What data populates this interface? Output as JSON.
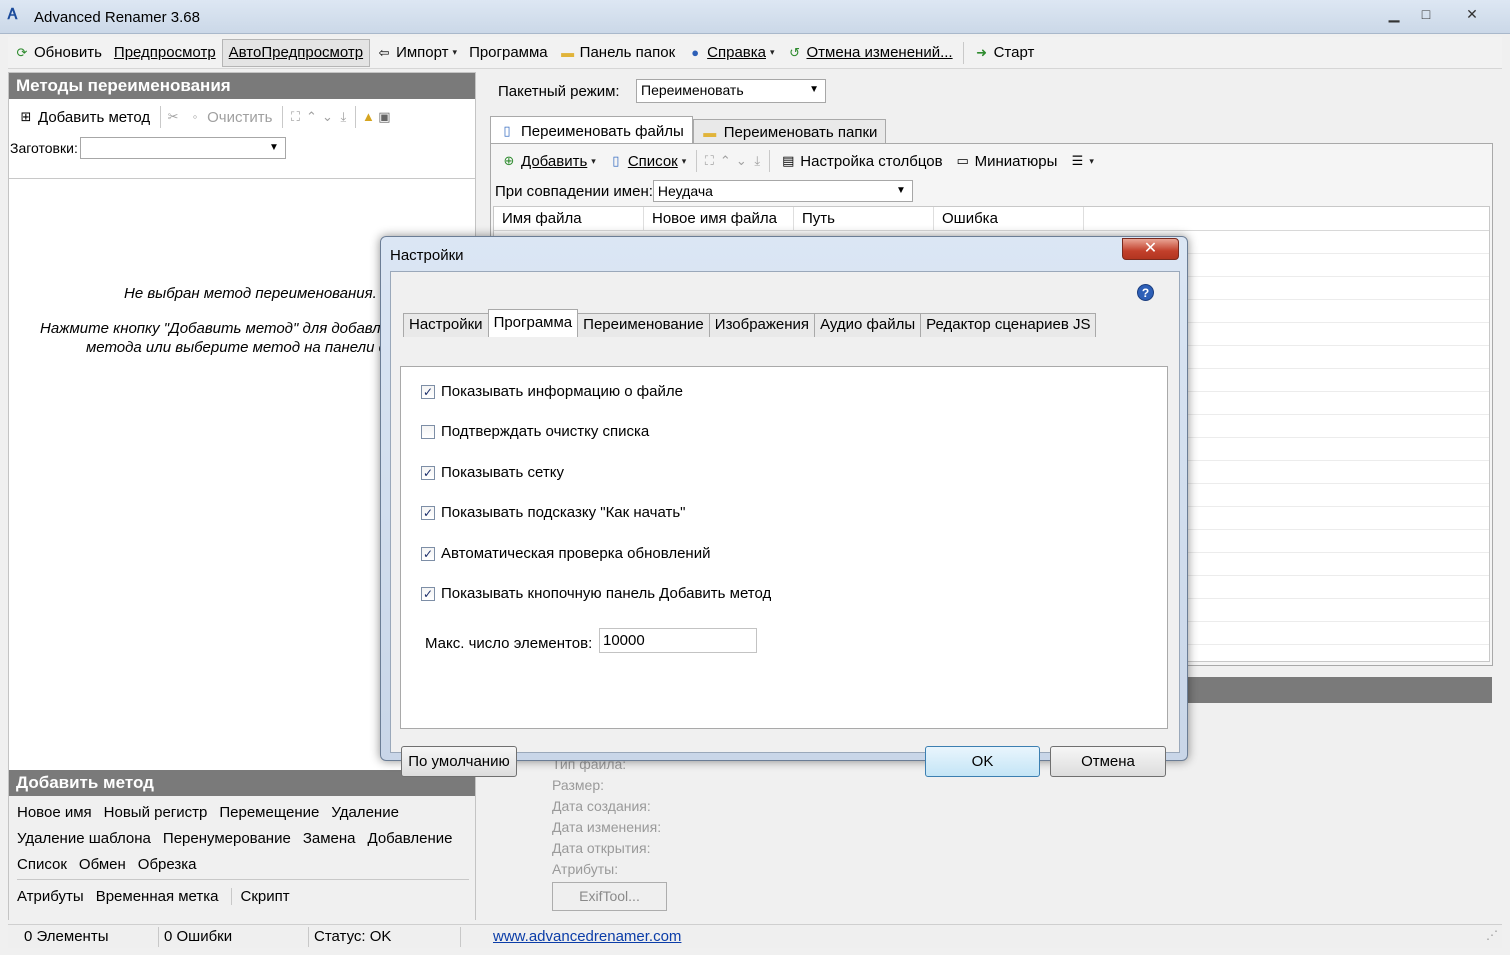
{
  "window": {
    "title": "Advanced Renamer 3.68",
    "icon": "app-icon",
    "minimize_glyph": "▁",
    "maximize_glyph": "□",
    "close_glyph": "✕"
  },
  "main_toolbar": {
    "refresh": "Обновить",
    "preview": "Предпросмотр",
    "autopreview": "АвтоПредпросмотр",
    "import": "Импорт",
    "program": "Программа",
    "folder_panel": "Панель папок",
    "help": "Справка",
    "undo": "Отмена изменений...",
    "start": "Старт"
  },
  "left_panel": {
    "header": "Методы переименования",
    "add_method": "Добавить метод",
    "clear": "Очистить",
    "presets_label": "Заготовки:",
    "presets_value": "",
    "hint_line1": "Не выбран метод переименования.",
    "hint_line2": "Нажмите кнопку \"Добавить метод\" для добавлен",
    "hint_line3": "метода или выберите метод на панели сн",
    "add_method_header": "Добавить метод",
    "methods_row1": [
      "Новое имя",
      "Новый регистр",
      "Перемещение",
      "Удаление"
    ],
    "methods_row2": [
      "Удаление шаблона",
      "Перенумерование",
      "Замена",
      "Добавление"
    ],
    "methods_row3": [
      "Список",
      "Обмен",
      "Обрезка"
    ],
    "methods_row4": [
      "Атрибуты",
      "Временная метка",
      "Скрипт"
    ]
  },
  "right_panel": {
    "batch_label": "Пакетный режим:",
    "batch_value": "Переименовать",
    "tab_files": "Переименовать файлы",
    "tab_folders": "Переименовать папки",
    "add": "Добавить",
    "list": "Список",
    "columns_setup": "Настройка столбцов",
    "thumbnails": "Миниатюры",
    "collision_label": "При совпадении имен:",
    "collision_value": "Неудача",
    "columns": [
      "Имя файла",
      "Новое имя файла",
      "Путь",
      "Ошибка"
    ]
  },
  "file_info": {
    "labels": [
      "Тип файла:",
      "Размер:",
      "Дата создания:",
      "Дата изменения:",
      "Дата открытия:",
      "Атрибуты:"
    ],
    "exiftool": "ExifTool..."
  },
  "status_bar": {
    "items": "0 Элементы",
    "errors": "0 Ошибки",
    "status": "Статус: OK",
    "link": "www.advancedrenamer.com"
  },
  "dialog": {
    "title": "Настройки",
    "help_glyph": "?",
    "tabs": [
      "Настройки",
      "Программа",
      "Переименование",
      "Изображения",
      "Аудио файлы",
      "Редактор сценариев JS"
    ],
    "active_tab": "Программа",
    "options": [
      {
        "label": "Показывать информацию о файле",
        "checked": true
      },
      {
        "label": "Подтверждать очистку списка",
        "checked": false
      },
      {
        "label": "Показывать сетку",
        "checked": true
      },
      {
        "label": "Показывать подсказку \"Как начать\"",
        "checked": true
      },
      {
        "label": "Автоматическая проверка обновлений",
        "checked": true
      },
      {
        "label": "Показывать кнопочную панель Добавить метод",
        "checked": true
      }
    ],
    "max_items_label": "Макс. число элементов:",
    "max_items_value": "10000",
    "defaults_button": "По умолчанию",
    "ok_button": "OK",
    "cancel_button": "Отмена"
  },
  "colors": {
    "panel_header": "#7a7a7a",
    "dialog_frame": "#c9d6e8",
    "close_button": "#c2402b",
    "link": "#0b3da8"
  }
}
